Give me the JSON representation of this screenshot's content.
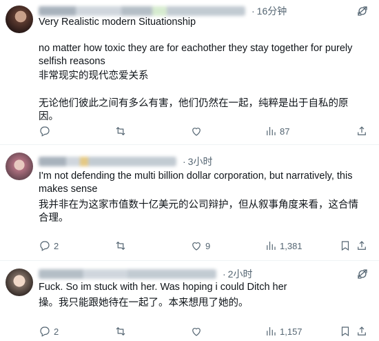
{
  "tweets": [
    {
      "time": "16分钟",
      "lines": [
        "Very Realistic modern Situationship",
        "no matter how toxic they are for eachother they stay together for purely selfish reasons",
        "非常现实的现代恋爱关系",
        "无论他们彼此之间有多么有害，他们仍然在一起，纯粹是出于自私的原因。"
      ],
      "replies": "",
      "retweets": "",
      "likes": "",
      "views": "87"
    },
    {
      "time": "3小时",
      "lines": [
        "I'm not defending the multi billion dollar corporation, but narratively, this makes sense",
        "我并非在为这家市值数十亿美元的公司辩护，但从叙事角度来看，这合情合理。"
      ],
      "replies": "2",
      "retweets": "",
      "likes": "9",
      "views": "1,381"
    },
    {
      "time": "2小时",
      "lines": [
        "Fuck. So im stuck with her. Was hoping i could Ditch her",
        "操。我只能跟她待在一起了。本来想甩了她的。"
      ],
      "replies": "2",
      "retweets": "",
      "likes": "",
      "views": "1,157"
    }
  ],
  "separator": "·",
  "icons": {
    "more": "grok-icon",
    "reply": "reply-icon",
    "retweet": "retweet-icon",
    "like": "heart-icon",
    "views": "views-icon",
    "bookmark": "bookmark-icon",
    "share": "share-icon"
  }
}
